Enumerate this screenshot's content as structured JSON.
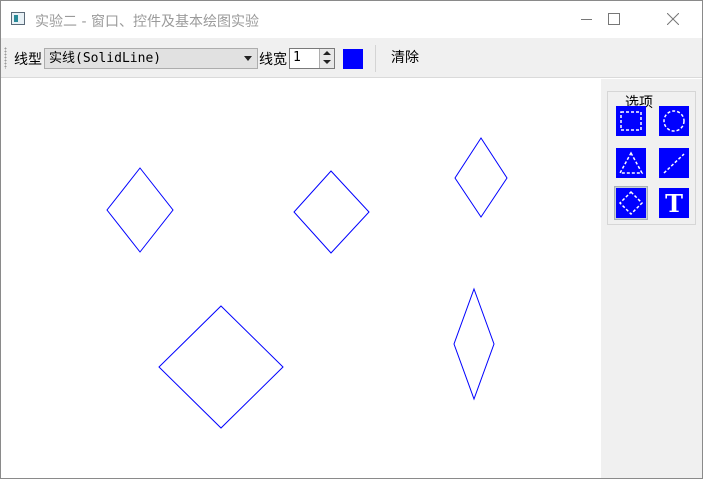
{
  "window": {
    "title": "实验二 - 窗口、控件及基本绘图实验",
    "controls": {
      "minimize": "—",
      "maximize": "☐",
      "close": "✕"
    }
  },
  "toolbar": {
    "line_style_label": "线型",
    "line_style_value": "实线(SolidLine)",
    "line_width_label": "线宽",
    "line_width_value": "1",
    "pen_color": "#0000ff",
    "clear_label": "清除"
  },
  "options_panel": {
    "title": "选项",
    "tools": [
      {
        "name": "rectangle-tool",
        "icon": "dashed-rectangle-icon",
        "selected": false
      },
      {
        "name": "ellipse-tool",
        "icon": "dashed-circle-icon",
        "selected": false
      },
      {
        "name": "triangle-tool",
        "icon": "dashed-triangle-icon",
        "selected": false
      },
      {
        "name": "line-tool",
        "icon": "dashed-line-icon",
        "selected": false
      },
      {
        "name": "diamond-tool",
        "icon": "dashed-diamond-icon",
        "selected": true
      },
      {
        "name": "text-tool",
        "icon": "text-t-icon",
        "label": "T",
        "selected": false
      }
    ],
    "icon_color": "#0000ff"
  },
  "canvas": {
    "stroke_color": "#0000ff",
    "shapes_drawn": 5
  }
}
